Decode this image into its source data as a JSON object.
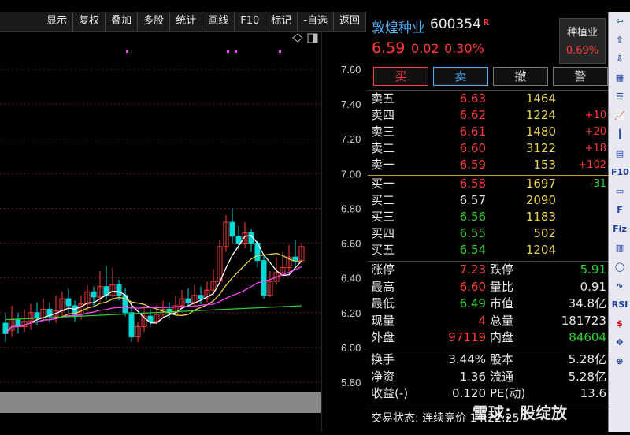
{
  "toolbar": {
    "buttons": [
      "显示",
      "复权",
      "叠加",
      "多股",
      "统计",
      "画线",
      "F10",
      "标记",
      "-自选",
      "返回"
    ]
  },
  "chart": {
    "y_ticks": [
      "7.60",
      "7.40",
      "7.20",
      "7.00",
      "6.80",
      "6.60",
      "6.40",
      "6.20",
      "6.00",
      "5.80"
    ],
    "colors": {
      "up": "#ff3b3b",
      "down": "#00d8d8",
      "ma5": "#ffffff",
      "ma10": "#e8d34a",
      "ma20": "#ff44ff",
      "ma60": "#2fd12f",
      "marker": "#ff44ff"
    }
  },
  "quote": {
    "name": "敦煌种业",
    "code": "600354",
    "badge": "R",
    "price": "6.59",
    "change": "0.02",
    "pct": "0.30%",
    "sector_name": "种植业",
    "sector_pct": "0.69%",
    "buttons": {
      "buy": "买",
      "sell": "卖",
      "cancel": "撤",
      "alert": "警"
    },
    "asks": [
      {
        "label": "卖五",
        "price": "6.63",
        "vol": "1464",
        "delta": ""
      },
      {
        "label": "卖四",
        "price": "6.62",
        "vol": "1224",
        "delta": "+10"
      },
      {
        "label": "卖三",
        "price": "6.61",
        "vol": "1480",
        "delta": "+20"
      },
      {
        "label": "卖二",
        "price": "6.60",
        "vol": "3122",
        "delta": "+18"
      },
      {
        "label": "卖一",
        "price": "6.59",
        "vol": "153",
        "delta": "+102"
      }
    ],
    "bids": [
      {
        "label": "买一",
        "price": "6.58",
        "vol": "1697",
        "delta": "-31"
      },
      {
        "label": "买二",
        "price": "6.57",
        "vol": "2090",
        "delta": ""
      },
      {
        "label": "买三",
        "price": "6.56",
        "vol": "1183",
        "delta": ""
      },
      {
        "label": "买四",
        "price": "6.55",
        "vol": "502",
        "delta": ""
      },
      {
        "label": "买五",
        "price": "6.54",
        "vol": "1204",
        "delta": ""
      }
    ],
    "stats1": [
      {
        "l1": "涨停",
        "v1": "7.23",
        "l2": "跌停",
        "v2": "5.91"
      },
      {
        "l1": "最高",
        "v1": "6.60",
        "l2": "量比",
        "v2": "0.91"
      },
      {
        "l1": "最低",
        "v1": "6.49",
        "l2": "市值",
        "v2": "34.8亿"
      },
      {
        "l1": "现量",
        "v1": "4",
        "l2": "总量",
        "v2": "181723"
      },
      {
        "l1": "外盘",
        "v1": "97119",
        "l2": "内盘",
        "v2": "84604"
      }
    ],
    "stats2": [
      {
        "l1": "换手",
        "v1": "3.44%",
        "l2": "股本",
        "v2": "5.28亿"
      },
      {
        "l1": "净资",
        "v1": "1.36",
        "l2": "流通",
        "v2": "5.28亿"
      },
      {
        "l1": "收益(-)",
        "v1": "0.120",
        "l2": "PE(动)",
        "v2": "13.6"
      }
    ],
    "status": "交易状态: 连续竞价 14:22:25"
  },
  "watermark": "雪球：股绽放",
  "rightbar_icons": [
    "arrow-left-icon",
    "arrow-up-icon",
    "arrow-down-icon",
    "grid-icon",
    "list-icon",
    "line-chart-icon",
    "candle-icon",
    "table-icon",
    "f10-icon",
    "doc-icon",
    "f-icon",
    "fiz-icon",
    "chart-icon",
    "circle-icon",
    "wave-icon",
    "rsi-icon",
    "dollar-icon",
    "move-icon",
    "zoom-icon"
  ],
  "rightbar_labels": {
    "f10": "F10",
    "fiz": "Fiz",
    "rsi": "RSI",
    "dollar": "$"
  }
}
